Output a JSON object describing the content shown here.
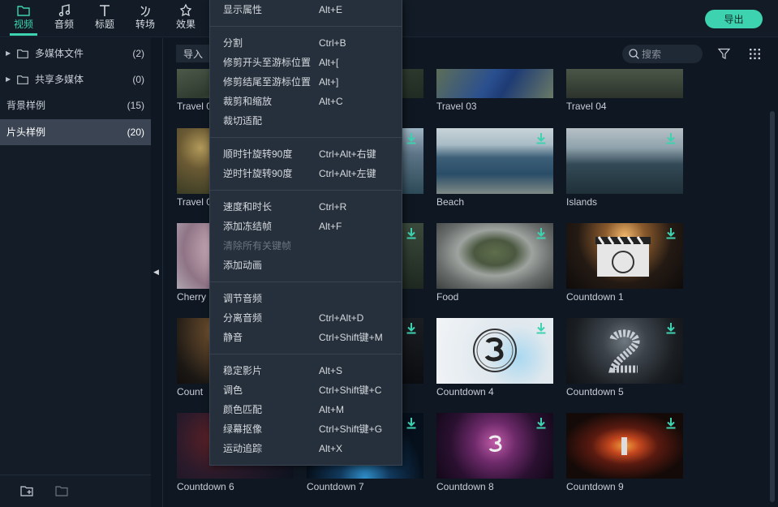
{
  "tabs": [
    {
      "label": "视频",
      "icon": "folder-icon"
    },
    {
      "label": "音频",
      "icon": "music-note-icon"
    },
    {
      "label": "标题",
      "icon": "text-title-icon"
    },
    {
      "label": "转场",
      "icon": "transition-icon"
    },
    {
      "label": "效果",
      "icon": "effects-icon"
    }
  ],
  "export_label": "导出",
  "sidebar": {
    "items": [
      {
        "label": "多媒体文件",
        "count": "(2)"
      },
      {
        "label": "共享多媒体",
        "count": "(0)"
      },
      {
        "label": "背景样例",
        "count": "(15)"
      },
      {
        "label": "片头样例",
        "count": "(20)"
      }
    ]
  },
  "toolbar": {
    "import_label": "导入",
    "search_placeholder": "搜索"
  },
  "tiles": [
    {
      "name": "Travel 0"
    },
    {
      "name": "Travel 03"
    },
    {
      "name": "Travel 04"
    },
    {
      "name": "Travel 0"
    },
    {
      "name": "Beach"
    },
    {
      "name": "Islands"
    },
    {
      "name": "Cherry"
    },
    {
      "name": "Food"
    },
    {
      "name": "Countdown 1"
    },
    {
      "name": "Count"
    },
    {
      "name": "Countdown 4"
    },
    {
      "name": "Countdown 5"
    },
    {
      "name": "Countdown 6"
    },
    {
      "name": "Countdown 7"
    },
    {
      "name": "Countdown 8"
    },
    {
      "name": "Countdown 9"
    }
  ],
  "context_menu": {
    "items": [
      {
        "label": "显示属性",
        "shortcut": "Alt+E"
      },
      {
        "label": "分割",
        "shortcut": "Ctrl+B"
      },
      {
        "label": "修剪开头至游标位置",
        "shortcut": "Alt+["
      },
      {
        "label": "修剪结尾至游标位置",
        "shortcut": "Alt+]"
      },
      {
        "label": "裁剪和缩放",
        "shortcut": "Alt+C"
      },
      {
        "label": "裁切适配",
        "shortcut": ""
      },
      {
        "label": "顺时针旋转90度",
        "shortcut": "Ctrl+Alt+右键"
      },
      {
        "label": "逆时针旋转90度",
        "shortcut": "Ctrl+Alt+左键"
      },
      {
        "label": "速度和时长",
        "shortcut": "Ctrl+R"
      },
      {
        "label": "添加冻结帧",
        "shortcut": "Alt+F"
      },
      {
        "label": "清除所有关键帧",
        "shortcut": ""
      },
      {
        "label": "添加动画",
        "shortcut": ""
      },
      {
        "label": "调节音频",
        "shortcut": ""
      },
      {
        "label": "分离音频",
        "shortcut": "Ctrl+Alt+D"
      },
      {
        "label": "静音",
        "shortcut": "Ctrl+Shift键+M"
      },
      {
        "label": "稳定影片",
        "shortcut": "Alt+S"
      },
      {
        "label": "调色",
        "shortcut": "Ctrl+Shift键+C"
      },
      {
        "label": "颜色匹配",
        "shortcut": "Alt+M"
      },
      {
        "label": "绿幕抠像",
        "shortcut": "Ctrl+Shift键+G"
      },
      {
        "label": "运动追踪",
        "shortcut": "Alt+X"
      }
    ]
  },
  "colors": {
    "accent": "#3ed3b0",
    "background": "#0f1722",
    "menu_background": "#26303c"
  }
}
